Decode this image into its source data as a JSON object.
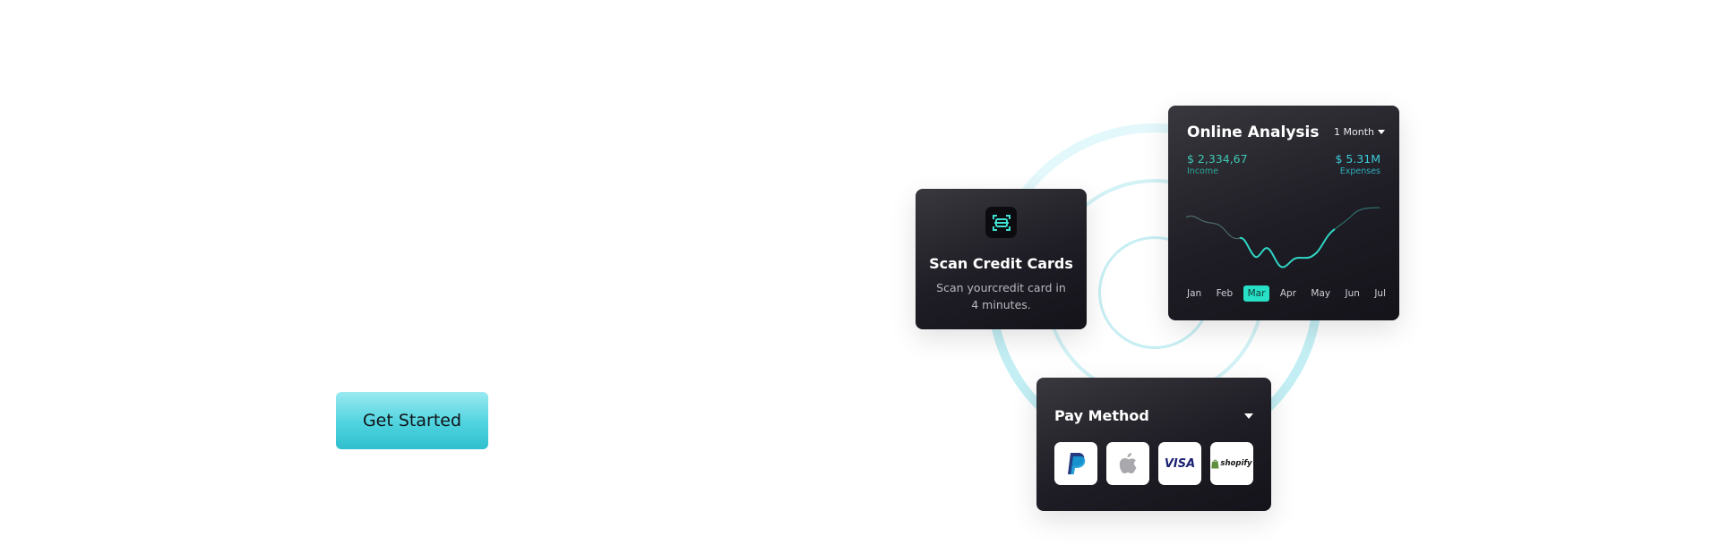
{
  "hero": {
    "cta_label": "Get Started"
  },
  "scan_card": {
    "icon": "scan-card-icon",
    "title": "Scan Credit Cards",
    "subtitle": "Scan yourcredit card in 4 minutes."
  },
  "analysis_card": {
    "title": "Online Analysis",
    "range_label": "1 Month",
    "income_value": "$ 2,334,67",
    "income_label": "Income",
    "expenses_value": "$ 5.31M",
    "expenses_label": "Expenses",
    "months": [
      "Jan",
      "Feb",
      "Mar",
      "Apr",
      "May",
      "Jun",
      "Jul"
    ],
    "active_month": "Mar"
  },
  "pay_card": {
    "title": "Pay Method",
    "methods": [
      "paypal-icon",
      "apple-icon",
      "visa-icon",
      "shopify-icon"
    ],
    "visa_text": "VISA",
    "shopify_text": "shopify"
  },
  "colors": {
    "accent": "#27e0c6",
    "cta": "#4fd3df",
    "card_dark": "#1e1c24"
  }
}
